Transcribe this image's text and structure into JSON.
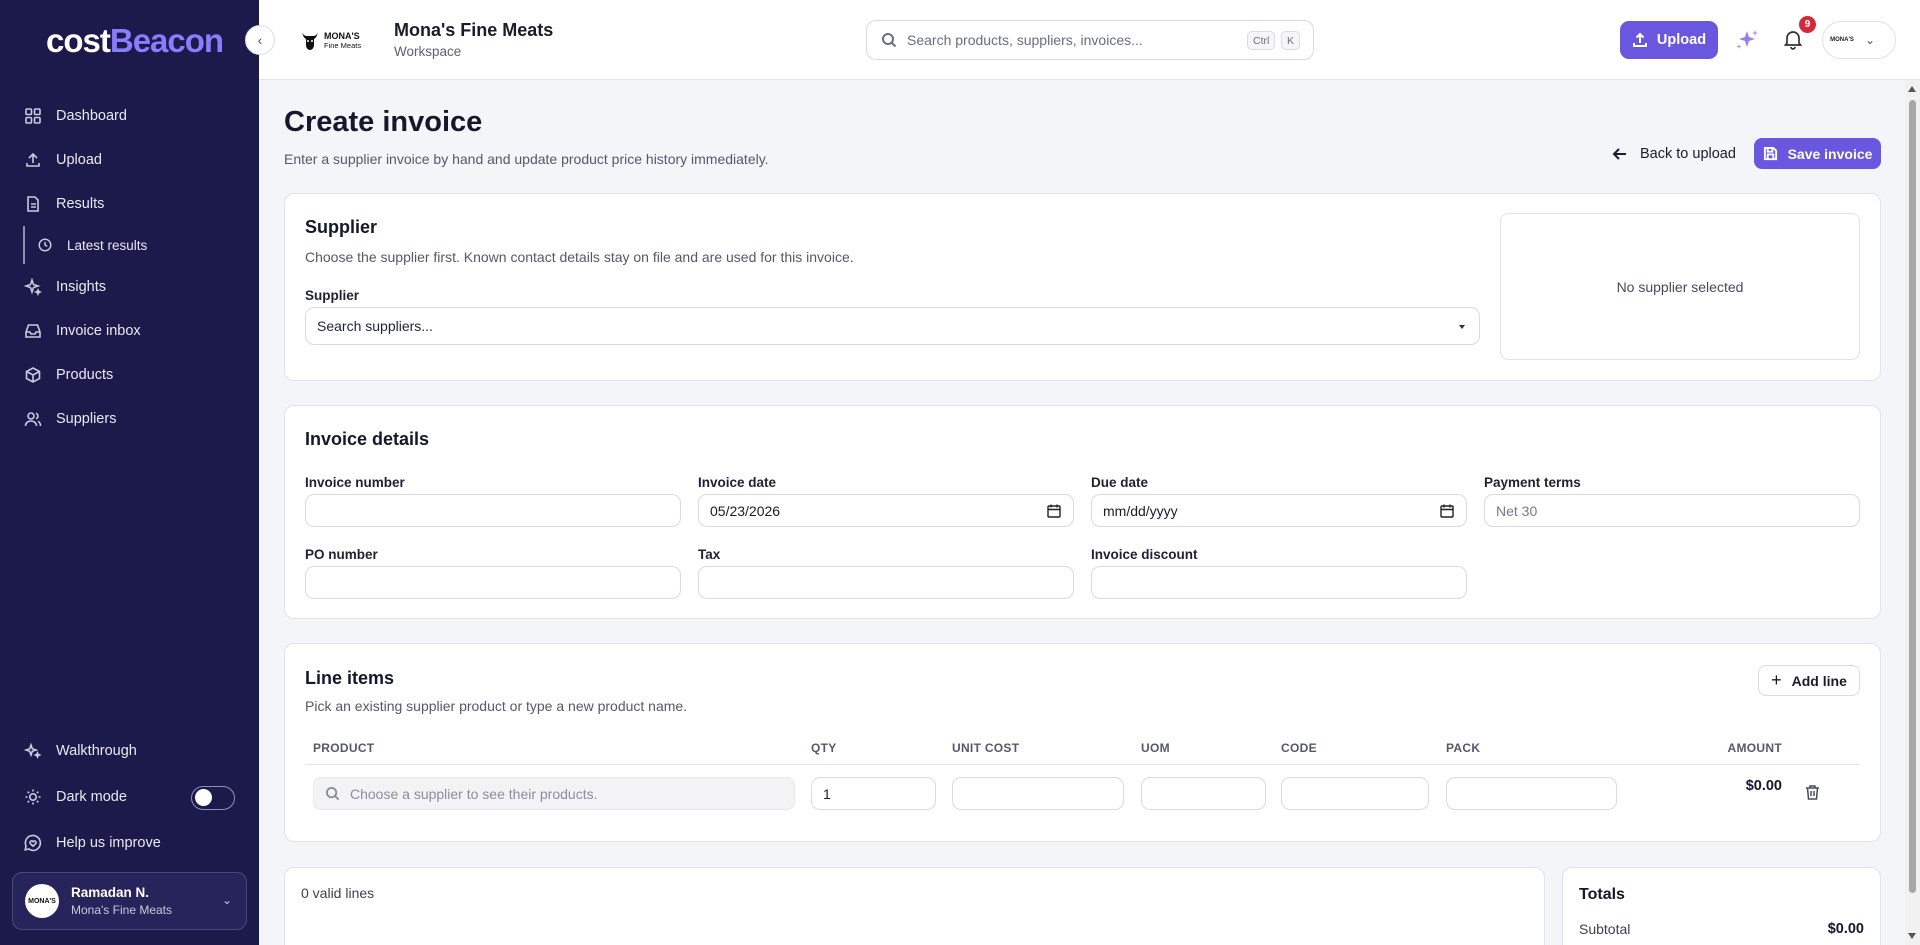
{
  "brand": {
    "logo_part1": "cost",
    "logo_part2": "Beacon"
  },
  "sidebar": {
    "items": [
      {
        "label": "Dashboard",
        "icon": "grid-icon"
      },
      {
        "label": "Upload",
        "icon": "upload-icon"
      },
      {
        "label": "Results",
        "icon": "document-icon"
      },
      {
        "label": "Latest results",
        "icon": "clock-icon"
      },
      {
        "label": "Insights",
        "icon": "sparkle-icon"
      },
      {
        "label": "Invoice inbox",
        "icon": "inbox-icon"
      },
      {
        "label": "Products",
        "icon": "box-icon"
      },
      {
        "label": "Suppliers",
        "icon": "users-icon"
      }
    ],
    "bottom": [
      {
        "label": "Walkthrough",
        "icon": "sparkle-icon"
      },
      {
        "label": "Dark mode",
        "icon": "sun-icon"
      },
      {
        "label": "Help us improve",
        "icon": "heart-chat-icon"
      }
    ],
    "user": {
      "name": "Ramadan N.",
      "org": "Mona's Fine Meats",
      "avatar_text": "MONA'S"
    }
  },
  "header": {
    "workspace_logo_line1": "MONA'S",
    "workspace_logo_line2": "Fine Meats",
    "workspace_name": "Mona's Fine Meats",
    "workspace_sub": "Workspace",
    "search_placeholder": "Search products, suppliers, invoices...",
    "kbd1": "Ctrl",
    "kbd2": "K",
    "upload_label": "Upload",
    "notification_count": "9",
    "account_avatar_text": "MONA'S"
  },
  "page": {
    "title": "Create invoice",
    "subtitle": "Enter a supplier invoice by hand and update product price history immediately.",
    "back_label": "Back to upload",
    "save_label": "Save invoice"
  },
  "supplier": {
    "title": "Supplier",
    "subtitle": "Choose the supplier first. Known contact details stay on file and are used for this invoice.",
    "field_label": "Supplier",
    "placeholder": "Search suppliers...",
    "empty_state": "No supplier selected"
  },
  "details": {
    "title": "Invoice details",
    "invoice_number_label": "Invoice number",
    "invoice_number_value": "",
    "invoice_date_label": "Invoice date",
    "invoice_date_value": "05/23/2026",
    "due_date_label": "Due date",
    "due_date_placeholder": "mm/dd/yyyy",
    "payment_terms_label": "Payment terms",
    "payment_terms_value": "Net 30",
    "po_label": "PO number",
    "po_value": "",
    "tax_label": "Tax",
    "tax_value": "",
    "discount_label": "Invoice discount",
    "discount_value": ""
  },
  "line_items": {
    "title": "Line items",
    "subtitle": "Pick an existing supplier product or type a new product name.",
    "add_label": "Add line",
    "columns": [
      "PRODUCT",
      "QTY",
      "UNIT COST",
      "UOM",
      "CODE",
      "PACK",
      "AMOUNT"
    ],
    "rows": [
      {
        "product_placeholder": "Choose a supplier to see their products.",
        "qty": "1",
        "unit_cost": "",
        "uom": "",
        "code": "",
        "pack": "",
        "amount": "$0.00"
      }
    ]
  },
  "summary": {
    "valid_lines": "0 valid lines",
    "totals_title": "Totals",
    "subtotal_label": "Subtotal",
    "subtotal_value": "$0.00"
  },
  "colors": {
    "sidebar_bg": "#1c1a4a",
    "accent": "#6a57e0",
    "badge": "#d22a3c"
  }
}
